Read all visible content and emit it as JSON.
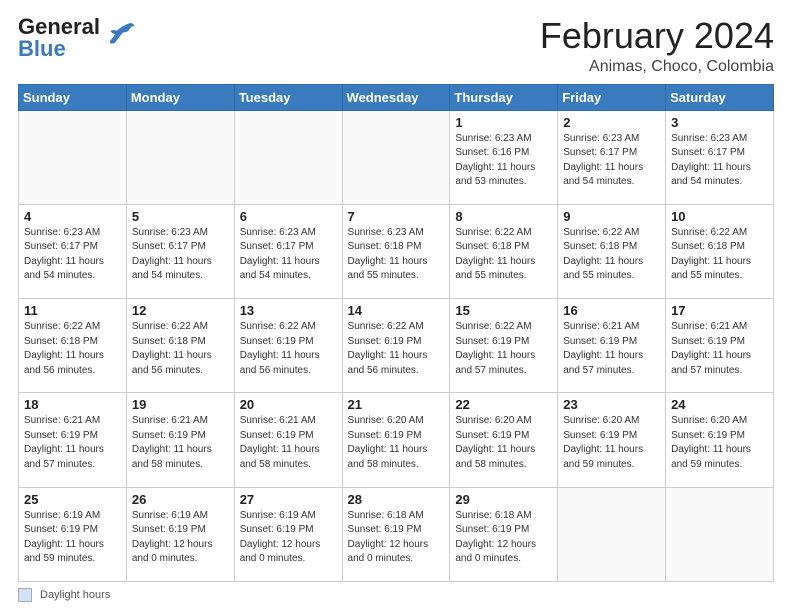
{
  "logo": {
    "line1": "General",
    "line2": "Blue"
  },
  "header": {
    "month_year": "February 2024",
    "location": "Animas, Choco, Colombia"
  },
  "days_of_week": [
    "Sunday",
    "Monday",
    "Tuesday",
    "Wednesday",
    "Thursday",
    "Friday",
    "Saturday"
  ],
  "footer": {
    "legend_label": "Daylight hours"
  },
  "weeks": [
    [
      {
        "day": "",
        "info": ""
      },
      {
        "day": "",
        "info": ""
      },
      {
        "day": "",
        "info": ""
      },
      {
        "day": "",
        "info": ""
      },
      {
        "day": "1",
        "info": "Sunrise: 6:23 AM\nSunset: 6:16 PM\nDaylight: 11 hours\nand 53 minutes."
      },
      {
        "day": "2",
        "info": "Sunrise: 6:23 AM\nSunset: 6:17 PM\nDaylight: 11 hours\nand 54 minutes."
      },
      {
        "day": "3",
        "info": "Sunrise: 6:23 AM\nSunset: 6:17 PM\nDaylight: 11 hours\nand 54 minutes."
      }
    ],
    [
      {
        "day": "4",
        "info": "Sunrise: 6:23 AM\nSunset: 6:17 PM\nDaylight: 11 hours\nand 54 minutes."
      },
      {
        "day": "5",
        "info": "Sunrise: 6:23 AM\nSunset: 6:17 PM\nDaylight: 11 hours\nand 54 minutes."
      },
      {
        "day": "6",
        "info": "Sunrise: 6:23 AM\nSunset: 6:17 PM\nDaylight: 11 hours\nand 54 minutes."
      },
      {
        "day": "7",
        "info": "Sunrise: 6:23 AM\nSunset: 6:18 PM\nDaylight: 11 hours\nand 55 minutes."
      },
      {
        "day": "8",
        "info": "Sunrise: 6:22 AM\nSunset: 6:18 PM\nDaylight: 11 hours\nand 55 minutes."
      },
      {
        "day": "9",
        "info": "Sunrise: 6:22 AM\nSunset: 6:18 PM\nDaylight: 11 hours\nand 55 minutes."
      },
      {
        "day": "10",
        "info": "Sunrise: 6:22 AM\nSunset: 6:18 PM\nDaylight: 11 hours\nand 55 minutes."
      }
    ],
    [
      {
        "day": "11",
        "info": "Sunrise: 6:22 AM\nSunset: 6:18 PM\nDaylight: 11 hours\nand 56 minutes."
      },
      {
        "day": "12",
        "info": "Sunrise: 6:22 AM\nSunset: 6:18 PM\nDaylight: 11 hours\nand 56 minutes."
      },
      {
        "day": "13",
        "info": "Sunrise: 6:22 AM\nSunset: 6:19 PM\nDaylight: 11 hours\nand 56 minutes."
      },
      {
        "day": "14",
        "info": "Sunrise: 6:22 AM\nSunset: 6:19 PM\nDaylight: 11 hours\nand 56 minutes."
      },
      {
        "day": "15",
        "info": "Sunrise: 6:22 AM\nSunset: 6:19 PM\nDaylight: 11 hours\nand 57 minutes."
      },
      {
        "day": "16",
        "info": "Sunrise: 6:21 AM\nSunset: 6:19 PM\nDaylight: 11 hours\nand 57 minutes."
      },
      {
        "day": "17",
        "info": "Sunrise: 6:21 AM\nSunset: 6:19 PM\nDaylight: 11 hours\nand 57 minutes."
      }
    ],
    [
      {
        "day": "18",
        "info": "Sunrise: 6:21 AM\nSunset: 6:19 PM\nDaylight: 11 hours\nand 57 minutes."
      },
      {
        "day": "19",
        "info": "Sunrise: 6:21 AM\nSunset: 6:19 PM\nDaylight: 11 hours\nand 58 minutes."
      },
      {
        "day": "20",
        "info": "Sunrise: 6:21 AM\nSunset: 6:19 PM\nDaylight: 11 hours\nand 58 minutes."
      },
      {
        "day": "21",
        "info": "Sunrise: 6:20 AM\nSunset: 6:19 PM\nDaylight: 11 hours\nand 58 minutes."
      },
      {
        "day": "22",
        "info": "Sunrise: 6:20 AM\nSunset: 6:19 PM\nDaylight: 11 hours\nand 58 minutes."
      },
      {
        "day": "23",
        "info": "Sunrise: 6:20 AM\nSunset: 6:19 PM\nDaylight: 11 hours\nand 59 minutes."
      },
      {
        "day": "24",
        "info": "Sunrise: 6:20 AM\nSunset: 6:19 PM\nDaylight: 11 hours\nand 59 minutes."
      }
    ],
    [
      {
        "day": "25",
        "info": "Sunrise: 6:19 AM\nSunset: 6:19 PM\nDaylight: 11 hours\nand 59 minutes."
      },
      {
        "day": "26",
        "info": "Sunrise: 6:19 AM\nSunset: 6:19 PM\nDaylight: 12 hours\nand 0 minutes."
      },
      {
        "day": "27",
        "info": "Sunrise: 6:19 AM\nSunset: 6:19 PM\nDaylight: 12 hours\nand 0 minutes."
      },
      {
        "day": "28",
        "info": "Sunrise: 6:18 AM\nSunset: 6:19 PM\nDaylight: 12 hours\nand 0 minutes."
      },
      {
        "day": "29",
        "info": "Sunrise: 6:18 AM\nSunset: 6:19 PM\nDaylight: 12 hours\nand 0 minutes."
      },
      {
        "day": "",
        "info": ""
      },
      {
        "day": "",
        "info": ""
      }
    ]
  ]
}
